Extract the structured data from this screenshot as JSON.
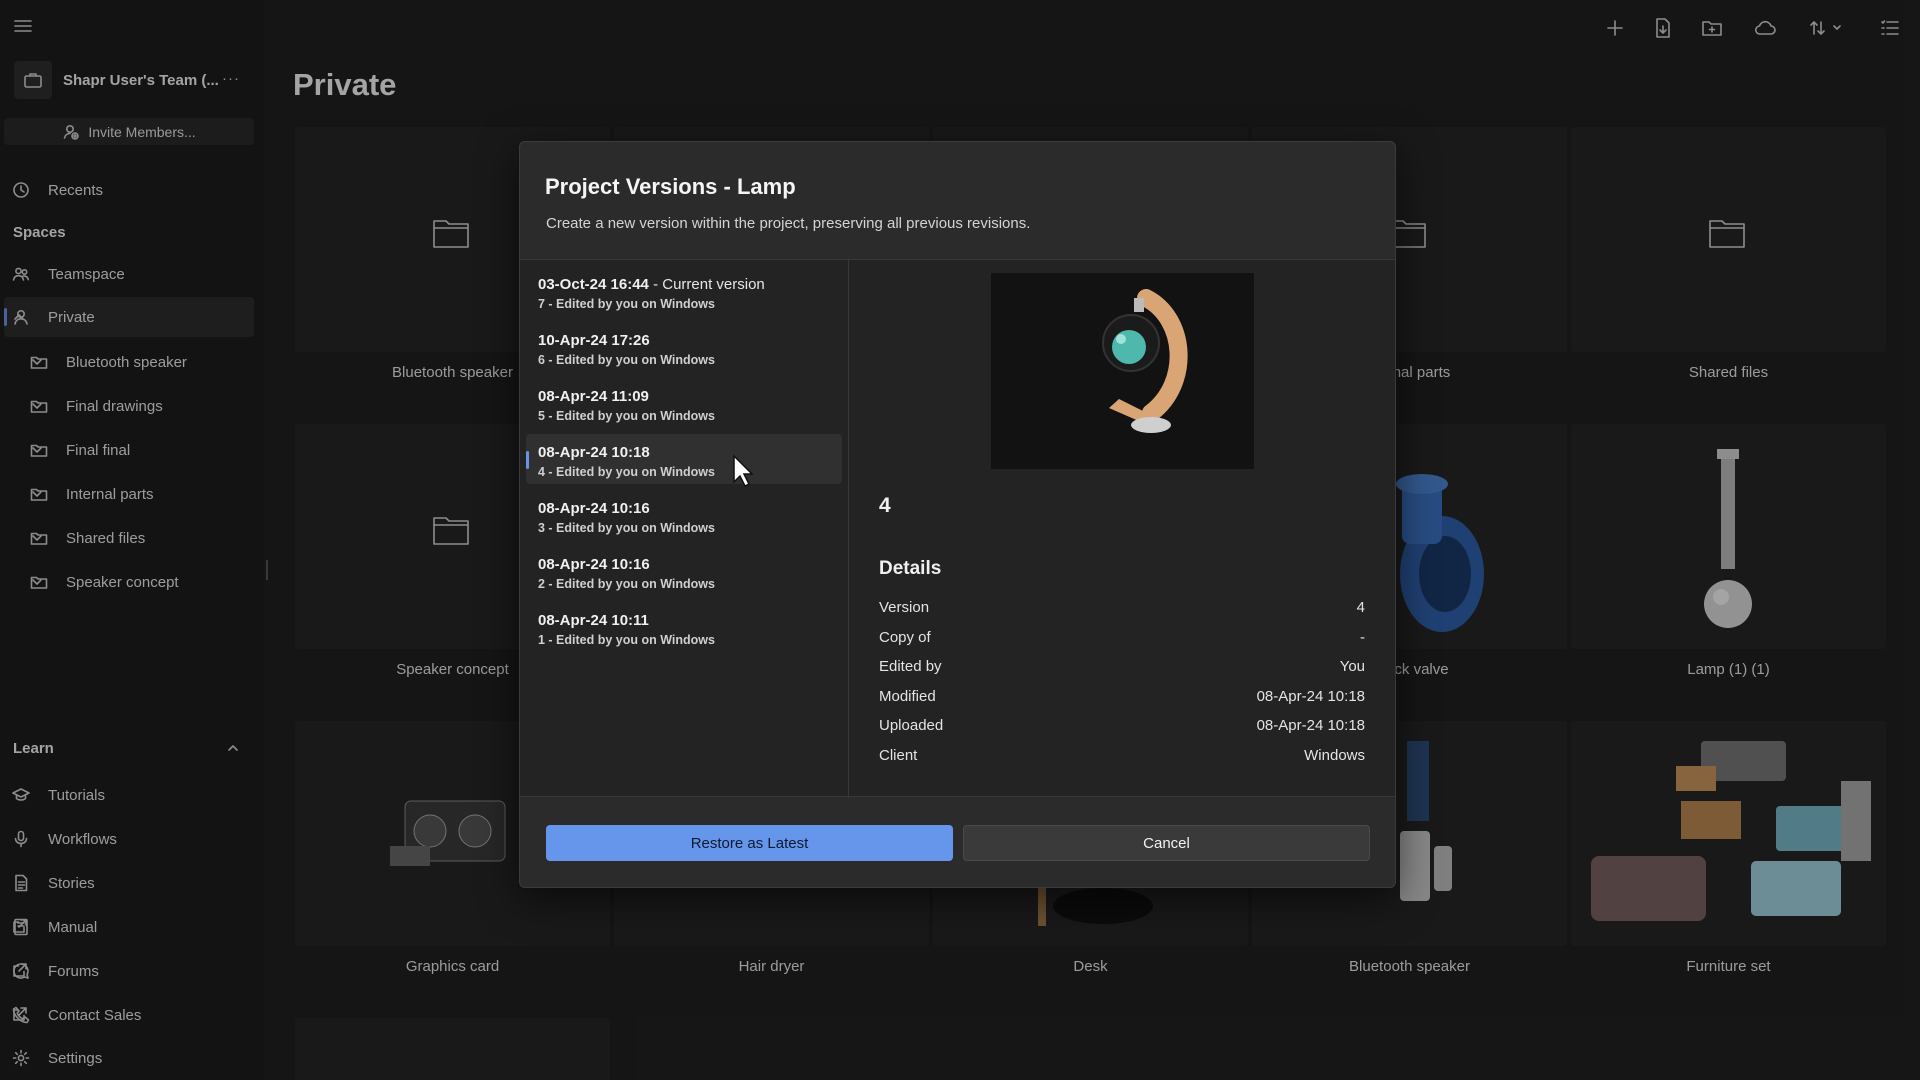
{
  "sidebar": {
    "team_name": "Shapr User's Team (...",
    "invite_label": "Invite Members...",
    "recents": "Recents",
    "spaces_header": "Spaces",
    "teamspace": "Teamspace",
    "private": "Private",
    "folders": [
      "Bluetooth speaker",
      "Final drawings",
      "Final final",
      "Internal parts",
      "Shared files",
      "Speaker concept"
    ],
    "learn_header": "Learn",
    "learn_items": [
      "Tutorials",
      "Workflows",
      "Stories",
      "Manual",
      "Forums",
      "Contact Sales"
    ],
    "settings": "Settings"
  },
  "main": {
    "title": "Private",
    "cards": [
      "Bluetooth speaker",
      "nal parts",
      "Shared files",
      "Speaker concept",
      "ck valve",
      "Lamp (1) (1)",
      "Graphics card",
      "Hair dryer",
      "Desk",
      "Bluetooth speaker",
      "Furniture set"
    ]
  },
  "dialog": {
    "title": "Project Versions - Lamp",
    "subtitle": "Create a new version within the project, preserving all previous revisions.",
    "versions": [
      {
        "date": "03-Oct-24 16:44",
        "current": " - Current version",
        "meta": "7 - Edited by you on Windows"
      },
      {
        "date": "10-Apr-24 17:26",
        "current": "",
        "meta": "6 - Edited by you on Windows"
      },
      {
        "date": "08-Apr-24 11:09",
        "current": "",
        "meta": "5 - Edited by you on Windows"
      },
      {
        "date": "08-Apr-24 10:18",
        "current": "",
        "meta": "4 - Edited by you on Windows"
      },
      {
        "date": "08-Apr-24 10:16",
        "current": "",
        "meta": "3 - Edited by you on Windows"
      },
      {
        "date": "08-Apr-24 10:16",
        "current": "",
        "meta": "2 - Edited by you on Windows"
      },
      {
        "date": "08-Apr-24 10:11",
        "current": "",
        "meta": "1 - Edited by you on Windows"
      }
    ],
    "selected_version": "4",
    "details_header": "Details",
    "details": [
      {
        "key": "Version",
        "value": "4"
      },
      {
        "key": "Copy of",
        "value": "-"
      },
      {
        "key": "Edited by",
        "value": "You"
      },
      {
        "key": "Modified",
        "value": "08-Apr-24 10:18"
      },
      {
        "key": "Uploaded",
        "value": "08-Apr-24 10:18"
      },
      {
        "key": "Client",
        "value": "Windows"
      }
    ],
    "restore_label": "Restore as Latest",
    "cancel_label": "Cancel"
  },
  "colors": {
    "accent": "#6596ec",
    "background": "#202020",
    "dialog": "#2b2b2b"
  }
}
